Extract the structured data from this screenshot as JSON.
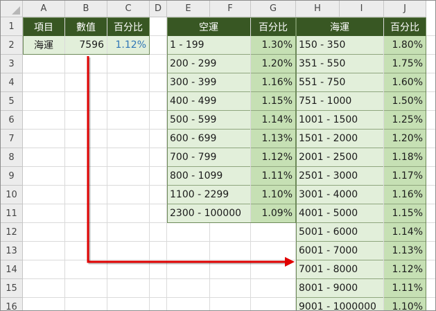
{
  "columns": [
    "A",
    "B",
    "C",
    "D",
    "E",
    "F",
    "G",
    "H",
    "I",
    "J"
  ],
  "rows": [
    "1",
    "2",
    "3",
    "4",
    "5",
    "6",
    "7",
    "8",
    "9",
    "10",
    "11",
    "12",
    "13",
    "14",
    "15",
    "16"
  ],
  "lookup": {
    "header": [
      "項目",
      "數值",
      "百分比"
    ],
    "item": "海運",
    "value": "7596",
    "percent": "1.12%"
  },
  "air_table": {
    "header_range": "空運",
    "header_rate": "百分比",
    "rows": [
      {
        "range": "1 - 199",
        "rate": "1.30%"
      },
      {
        "range": "200 - 299",
        "rate": "1.20%"
      },
      {
        "range": "300 - 399",
        "rate": "1.16%"
      },
      {
        "range": "400 - 499",
        "rate": "1.15%"
      },
      {
        "range": "500 - 599",
        "rate": "1.14%"
      },
      {
        "range": "600 - 699",
        "rate": "1.13%"
      },
      {
        "range": "700 - 799",
        "rate": "1.12%"
      },
      {
        "range": "800 - 1099",
        "rate": "1.11%"
      },
      {
        "range": "1100 - 2299",
        "rate": "1.10%"
      },
      {
        "range": "2300 - 100000",
        "rate": "1.09%"
      }
    ]
  },
  "sea_table": {
    "header_range": "海運",
    "header_rate": "百分比",
    "rows": [
      {
        "range": "150 - 350",
        "rate": "1.80%"
      },
      {
        "range": "351 - 550",
        "rate": "1.75%"
      },
      {
        "range": "551 - 750",
        "rate": "1.60%"
      },
      {
        "range": "751 - 1000",
        "rate": "1.50%"
      },
      {
        "range": "1001 - 1500",
        "rate": "1.25%"
      },
      {
        "range": "1501 - 2000",
        "rate": "1.20%"
      },
      {
        "range": "2001 - 2500",
        "rate": "1.18%"
      },
      {
        "range": "2501 - 3000",
        "rate": "1.17%"
      },
      {
        "range": "3001 - 4000",
        "rate": "1.16%"
      },
      {
        "range": "4001 - 5000",
        "rate": "1.15%"
      },
      {
        "range": "5001 - 6000",
        "rate": "1.14%"
      },
      {
        "range": "6001 - 7000",
        "rate": "1.13%"
      },
      {
        "range": "7001 - 8000",
        "rate": "1.12%"
      },
      {
        "range": "8001 - 9000",
        "rate": "1.11%"
      },
      {
        "range": "9001 - 1000000",
        "rate": "1.10%"
      }
    ]
  },
  "colors": {
    "header_dark_green": "#385723",
    "cell_light_green": "#e2efda",
    "cell_mid_green": "#c6e0b4",
    "arrow_red": "#e00000",
    "percent_blue": "#2e75b6"
  }
}
